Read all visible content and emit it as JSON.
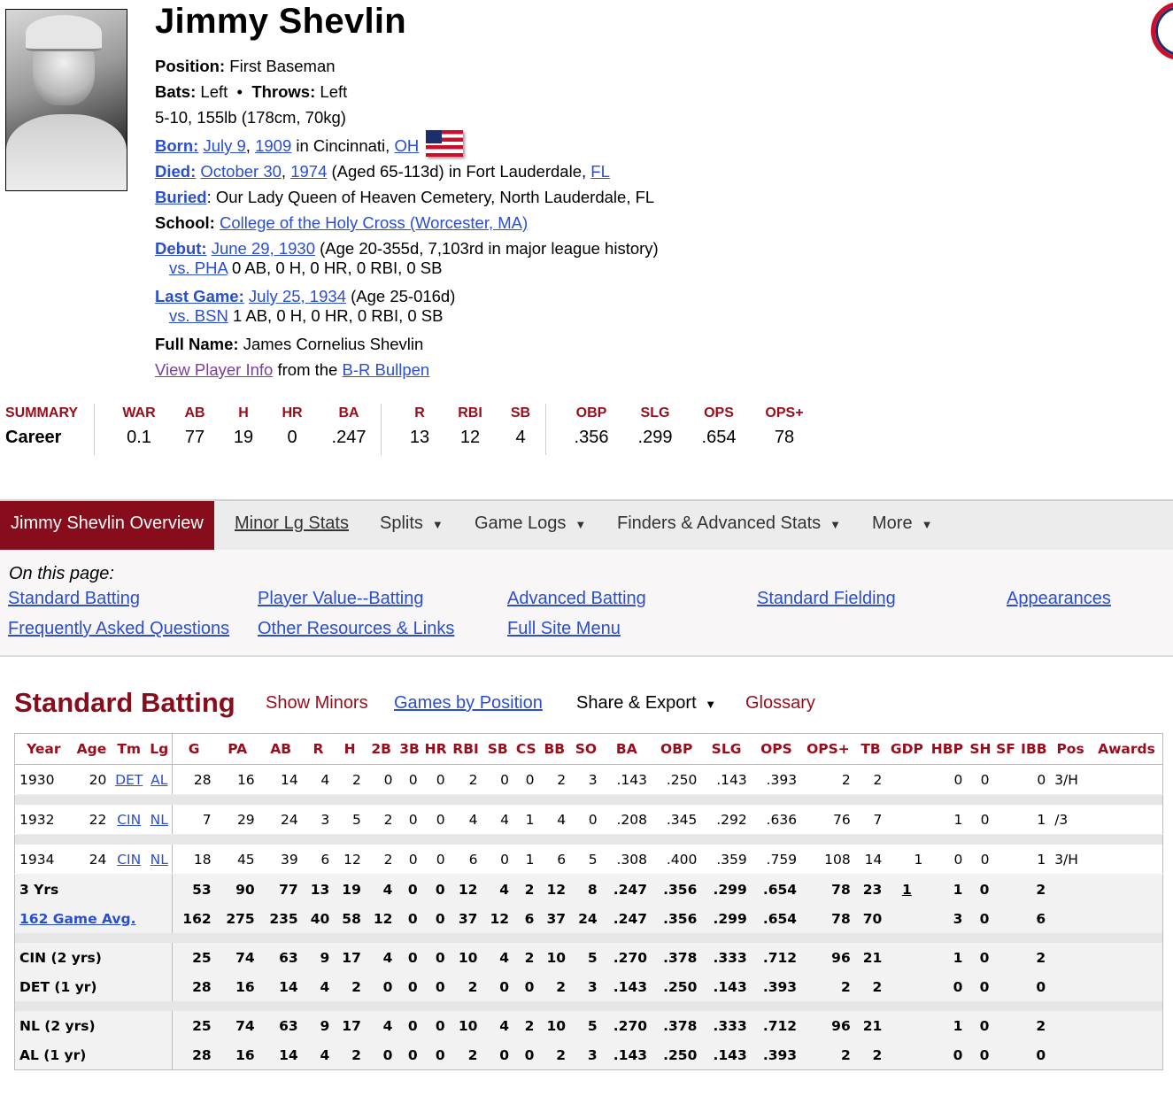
{
  "player": {
    "name": "Jimmy Shevlin",
    "position_label": "Position:",
    "position": "First Baseman",
    "bats_label": "Bats:",
    "bats": "Left",
    "throws_label": "Throws:",
    "throws": "Left",
    "size": "5-10, 155lb (178cm, 70kg)",
    "born_label": "Born:",
    "born_date": "July 9",
    "born_year": "1909",
    "born_city": "in Cincinnati,",
    "born_state": "OH",
    "died_label": "Died:",
    "died_date": "October 30",
    "died_year": "1974",
    "died_rest": "(Aged 65-113d) in Fort Lauderdale,",
    "died_state": "FL",
    "buried_label": "Buried",
    "buried": ": Our Lady Queen of Heaven Cemetery, North Lauderdale, FL",
    "school_label": "School:",
    "school": "College of the Holy Cross (Worcester, MA)",
    "debut_label": "Debut:",
    "debut_date": "June 29, 1930",
    "debut_rest": "(Age 20-355d, 7,103rd in major league history)",
    "debut_vs": "vs. PHA",
    "debut_line": "0 AB, 0 H, 0 HR, 0 RBI, 0 SB",
    "last_label": "Last Game:",
    "last_date": "July 25, 1934",
    "last_rest": "(Age 25-016d)",
    "last_vs": "vs. BSN",
    "last_line": "1 AB, 0 H, 0 HR, 0 RBI, 0 SB",
    "fullname_label": "Full Name:",
    "fullname": "James Cornelius Shevlin",
    "view_info": "View Player Info",
    "from_the": "from the",
    "bullpen": "B-R Bullpen"
  },
  "summary": {
    "label": "SUMMARY",
    "row_label": "Career",
    "stats": [
      {
        "h": "WAR",
        "v": "0.1"
      },
      {
        "h": "AB",
        "v": "77"
      },
      {
        "h": "H",
        "v": "19"
      },
      {
        "h": "HR",
        "v": "0"
      },
      {
        "h": "BA",
        "v": ".247"
      },
      {
        "h": "R",
        "v": "13"
      },
      {
        "h": "RBI",
        "v": "12"
      },
      {
        "h": "SB",
        "v": "4"
      },
      {
        "h": "OBP",
        "v": ".356"
      },
      {
        "h": "SLG",
        "v": ".299"
      },
      {
        "h": "OPS",
        "v": ".654"
      },
      {
        "h": "OPS+",
        "v": "78"
      }
    ]
  },
  "nav": {
    "tabs": [
      "Jimmy Shevlin Overview",
      "Minor Lg Stats",
      "Splits",
      "Game Logs",
      "Finders & Advanced Stats",
      "More"
    ],
    "caret": "▼"
  },
  "on_this_page": {
    "title": "On this page:",
    "links": [
      "Standard Batting",
      "Player Value--Batting",
      "Advanced Batting",
      "Standard Fielding",
      "Appearances",
      "Frequently Asked Questions",
      "Other Resources & Links",
      "Full Site Menu"
    ]
  },
  "batting": {
    "title": "Standard Batting",
    "show_minors": "Show Minors",
    "games_by_position": "Games by Position",
    "share_export": "Share & Export",
    "glossary": "Glossary",
    "headers": [
      "Year",
      "Age",
      "Tm",
      "Lg",
      "G",
      "PA",
      "AB",
      "R",
      "H",
      "2B",
      "3B",
      "HR",
      "RBI",
      "SB",
      "CS",
      "BB",
      "SO",
      "BA",
      "OBP",
      "SLG",
      "OPS",
      "OPS+",
      "TB",
      "GDP",
      "HBP",
      "SH",
      "SF",
      "IBB",
      "Pos",
      "Awards"
    ],
    "seasons": [
      [
        "1930",
        "20",
        "DET",
        "AL",
        "28",
        "16",
        "14",
        "4",
        "2",
        "0",
        "0",
        "0",
        "2",
        "0",
        "0",
        "2",
        "3",
        ".143",
        ".250",
        ".143",
        ".393",
        "2",
        "2",
        "",
        "0",
        "0",
        "",
        "0",
        "3/H",
        ""
      ],
      [
        "1932",
        "22",
        "CIN",
        "NL",
        "7",
        "29",
        "24",
        "3",
        "5",
        "2",
        "0",
        "0",
        "4",
        "4",
        "1",
        "4",
        "0",
        ".208",
        ".345",
        ".292",
        ".636",
        "76",
        "7",
        "",
        "1",
        "0",
        "",
        "1",
        "/3",
        ""
      ],
      [
        "1934",
        "24",
        "CIN",
        "NL",
        "18",
        "45",
        "39",
        "6",
        "12",
        "2",
        "0",
        "0",
        "6",
        "0",
        "1",
        "6",
        "5",
        ".308",
        ".400",
        ".359",
        ".759",
        "108",
        "14",
        "1",
        "0",
        "0",
        "",
        "1",
        "3/H",
        ""
      ]
    ],
    "totals": [
      [
        "3 Yrs",
        "53",
        "90",
        "77",
        "13",
        "19",
        "4",
        "0",
        "0",
        "12",
        "4",
        "2",
        "12",
        "8",
        ".247",
        ".356",
        ".299",
        ".654",
        "78",
        "23",
        "1",
        "1",
        "0",
        "",
        "2",
        "",
        ""
      ],
      [
        "162 Game Avg.",
        "162",
        "275",
        "235",
        "40",
        "58",
        "12",
        "0",
        "0",
        "37",
        "12",
        "6",
        "37",
        "24",
        ".247",
        ".356",
        ".299",
        ".654",
        "78",
        "70",
        "",
        "3",
        "0",
        "",
        "6",
        "",
        ""
      ]
    ],
    "teams": [
      [
        "CIN (2 yrs)",
        "25",
        "74",
        "63",
        "9",
        "17",
        "4",
        "0",
        "0",
        "10",
        "4",
        "2",
        "10",
        "5",
        ".270",
        ".378",
        ".333",
        ".712",
        "96",
        "21",
        "",
        "1",
        "0",
        "",
        "2",
        "",
        ""
      ],
      [
        "DET (1 yr)",
        "28",
        "16",
        "14",
        "4",
        "2",
        "0",
        "0",
        "0",
        "2",
        "0",
        "0",
        "2",
        "3",
        ".143",
        ".250",
        ".143",
        ".393",
        "2",
        "2",
        "",
        "0",
        "0",
        "",
        "0",
        "",
        ""
      ]
    ],
    "leagues": [
      [
        "NL (2 yrs)",
        "25",
        "74",
        "63",
        "9",
        "17",
        "4",
        "0",
        "0",
        "10",
        "4",
        "2",
        "10",
        "5",
        ".270",
        ".378",
        ".333",
        ".712",
        "96",
        "21",
        "",
        "1",
        "0",
        "",
        "2",
        "",
        ""
      ],
      [
        "AL (1 yr)",
        "28",
        "16",
        "14",
        "4",
        "2",
        "0",
        "0",
        "0",
        "2",
        "0",
        "0",
        "2",
        "3",
        ".143",
        ".250",
        ".143",
        ".393",
        "2",
        "2",
        "",
        "0",
        "0",
        "",
        "0",
        "",
        ""
      ]
    ]
  }
}
